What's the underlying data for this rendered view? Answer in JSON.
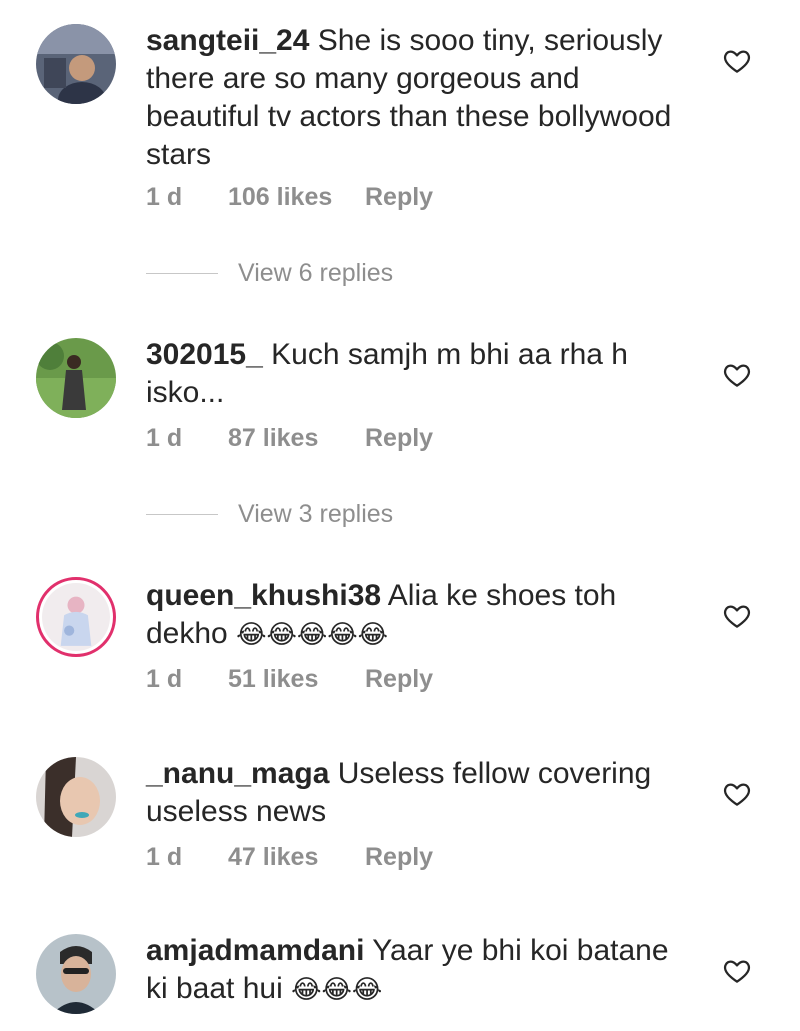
{
  "comments": [
    {
      "username": "sangteii_24",
      "text": "She is sooo tiny, seriously there are so many gorgeous and beautiful tv actors than these bollywood stars",
      "emoji": "",
      "time": "1 d",
      "likes": "106 likes",
      "reply": "Reply",
      "view_replies": "View 6 replies"
    },
    {
      "username": "302015_",
      "text": "Kuch samjh m bhi aa rha h isko...",
      "emoji": "",
      "time": "1 d",
      "likes": "87 likes",
      "reply": "Reply",
      "view_replies": "View 3 replies"
    },
    {
      "username": "queen_khushi38",
      "text": "Alia ke shoes toh dekho",
      "emoji": "😂😂😂😂😂",
      "time": "1 d",
      "likes": "51 likes",
      "reply": "Reply"
    },
    {
      "username": "_nanu_maga",
      "text": "Useless fellow covering useless news",
      "emoji": "",
      "time": "1 d",
      "likes": "47 likes",
      "reply": "Reply"
    },
    {
      "username": "amjadmamdani",
      "text": "Yaar ye bhi koi batane ki baat hui",
      "emoji": "😂😂😂"
    }
  ],
  "icons": {
    "like": "heart-outline-icon"
  },
  "colors": {
    "text": "#262626",
    "meta": "#8e8e8e",
    "story_ring": "#e1306c"
  }
}
